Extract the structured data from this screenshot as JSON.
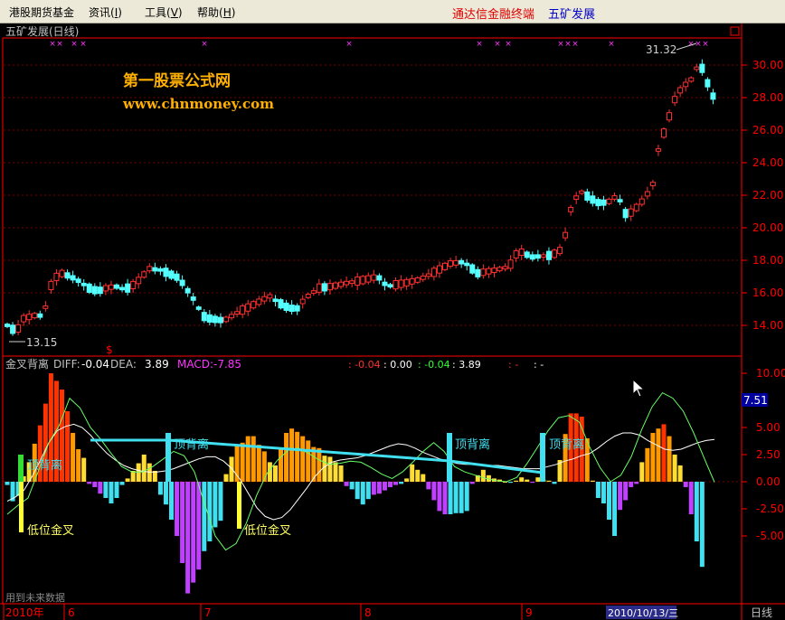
{
  "menu": {
    "items": [
      {
        "label": "港股期货基金",
        "key": ""
      },
      {
        "label": "资讯",
        "key": "I"
      },
      {
        "label": "工具",
        "key": "V"
      },
      {
        "label": "帮助",
        "key": "H"
      }
    ],
    "brand_terminal": "通达信金融终端",
    "brand_stock": "五矿发展"
  },
  "colors": {
    "price_axis": "#ff0000",
    "up_candle": "#ff3030",
    "down_candle": "#54ffff",
    "macd_up": [
      "#ff3300",
      "#ff9900",
      "#ffdd33"
    ],
    "macd_down": [
      "#40e0f0",
      "#c040ff"
    ],
    "dea_line": "#ffffff",
    "diff_line": "#66ff66",
    "trend_line": "#40e0f0",
    "watermark": "#ffb000"
  },
  "price_panel": {
    "title": "五矿发展(日线)",
    "watermark_title": "第一股票公式网",
    "watermark_url": "www.chnmoney.com",
    "high_label": "31.32",
    "low_label": "13.15",
    "axis": [
      "30.00",
      "28.00",
      "26.00",
      "24.00",
      "22.00",
      "20.00",
      "18.00",
      "16.00",
      "14.00"
    ],
    "signal_mark": "$"
  },
  "indicator_panel": {
    "name": "金叉背离",
    "diff_label": "DIFF:",
    "diff_value": "-0.04",
    "dea_label": "DEA:",
    "dea_value": "3.89",
    "macd_label": "MACD:",
    "macd_value": "-7.85",
    "extra_values": [
      ": -0.04",
      ": 0.00",
      ": -0.04",
      ": 3.89",
      ": -",
      ": -"
    ],
    "axis": [
      "10.00",
      "7.51",
      "5.00",
      "2.50",
      "0.00",
      "-2.50",
      "-5.00"
    ],
    "current_value": "7.51",
    "annotations": [
      "顶背离",
      "顶背离",
      "顶背离",
      "顶背离",
      "低位金叉",
      "低位金叉"
    ],
    "note": "用到未来数据",
    "chart_data": {
      "type": "bar",
      "title": "",
      "ylim": [
        -11,
        11
      ],
      "y_ticks": [
        10.0,
        7.5,
        5.0,
        2.5,
        0.0,
        -2.5,
        -5.0
      ],
      "series": [
        {
          "name": "MACD",
          "values": [
            -0.3,
            -1.8,
            -1.3,
            0.5,
            1.8,
            3.5,
            5.2,
            7.2,
            10,
            9.3,
            8.5,
            6.5,
            4.5,
            3.0,
            2.2,
            -0.2,
            -0.5,
            -1.1,
            -1.5,
            -2.0,
            -1.5,
            -0.3,
            0.3,
            1.0,
            1.7,
            2.5,
            1.7,
            1.0,
            -1.2,
            -2.1,
            -3.5,
            -5.0,
            -7.5,
            -10.3,
            -9.3,
            -8.1,
            -6.4,
            -5.5,
            -4.2,
            -3.6,
            0.7,
            2.3,
            3.3,
            3.6,
            4.2,
            4.2,
            3.4,
            2.8,
            1.8,
            1.5,
            3.0,
            4.5,
            4.9,
            4.6,
            4.2,
            3.8,
            3.2,
            3.1,
            2.4,
            2.3,
            1.8,
            1.5,
            -0.4,
            -0.7,
            -1.6,
            -2.1,
            -1.6,
            -1.2,
            -1.1,
            -0.8,
            -0.5,
            -0.3,
            -0.2,
            0.3,
            1.6,
            1.1,
            0.7,
            -0.7,
            -1.7,
            -2.7,
            -3.0,
            -3.0,
            -2.9,
            -2.9,
            -2.7,
            -0.2,
            0.6,
            1.1,
            0.6,
            0.3,
            0.2,
            0.0,
            -0.1,
            0.1,
            0.4,
            0.2,
            -0.1,
            0.4,
            0.2,
            0.1,
            -0.2,
            2.0,
            4.4,
            6.3,
            6.3,
            6.0,
            4.0,
            0.1,
            -1.5,
            -2.0,
            -3.5,
            -5.0,
            -2.6,
            -1.7,
            -0.5,
            -0.2,
            1.8,
            3.1,
            4.5,
            4.9,
            5.3,
            4.2,
            2.5,
            1.5,
            -0.5,
            -3.0,
            -5.5,
            -7.85
          ]
        },
        {
          "name": "DEA",
          "values": [
            -1.8,
            -1.4,
            -0.8,
            0.5,
            2.0,
            3.6,
            4.7,
            5.1,
            5.3,
            5.0,
            4.3,
            3.4,
            2.6,
            2.0,
            1.5,
            1.2,
            1.0,
            0.9,
            0.9,
            1.0,
            1.2,
            1.5,
            1.8,
            2.1,
            2.3,
            2.3,
            1.9,
            1.2,
            0.2,
            -1.1,
            -2.4,
            -3.2,
            -3.5,
            -3.3,
            -2.6,
            -1.6,
            -0.6,
            0.5,
            1.3,
            1.8,
            2.0,
            2.1,
            2.2,
            2.4,
            2.7,
            3.0,
            3.3,
            3.5,
            3.4,
            3.1,
            2.7,
            2.4,
            2.1,
            1.9,
            1.7,
            1.6,
            1.6,
            1.6,
            1.5,
            1.5,
            1.4,
            1.3,
            1.2,
            1.2,
            1.2,
            1.4,
            1.6,
            1.9,
            2.1,
            2.4,
            2.6,
            3.1,
            3.7,
            4.2,
            4.5,
            4.5,
            4.3,
            3.8,
            3.4,
            3.0,
            2.9,
            3.0,
            3.3,
            3.6,
            3.8,
            3.89
          ]
        },
        {
          "name": "DIFF",
          "values": [
            -3.0,
            -2.2,
            -1.5,
            1.0,
            3.6,
            5.2,
            7.7,
            6.8,
            5.0,
            3.9,
            2.6,
            1.4,
            0.9,
            0.9,
            1.4,
            2.1,
            2.8,
            2.4,
            0.9,
            -2.1,
            -5.0,
            -6.3,
            -5.7,
            -3.8,
            -1.2,
            0.8,
            2.0,
            2.9,
            3.1,
            2.6,
            2.0,
            1.6,
            1.7,
            1.9,
            1.8,
            1.3,
            0.7,
            0.3,
            0.9,
            1.8,
            2.8,
            3.6,
            2.8,
            1.4,
            0.9,
            0.6,
            0.3,
            0.1,
            0.0,
            0.4,
            1.7,
            3.2,
            4.7,
            5.9,
            6.1,
            5.5,
            3.2,
            1.3,
            0.0,
            0.6,
            2.3,
            4.8,
            6.9,
            8.2,
            7.7,
            6.5,
            4.5,
            2.2,
            -0.04
          ]
        }
      ]
    }
  },
  "timeline": {
    "labels": [
      "2010年",
      "6",
      "7",
      "8",
      "9",
      "2010/10/13/三"
    ],
    "period": "日线"
  }
}
